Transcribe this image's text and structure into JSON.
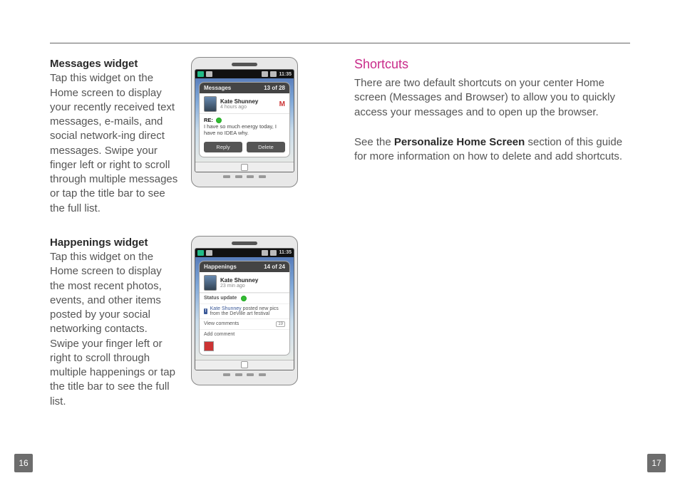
{
  "page_numbers": {
    "left": "16",
    "right": "17"
  },
  "left_column": {
    "messages_widget": {
      "heading": "Messages widget",
      "body": "Tap this widget on the Home screen to display your recently received text messages, e-mails, and social network-ing direct messages. Swipe your finger left or right to scroll through multiple messages or tap the title bar to see the full list."
    },
    "happenings_widget": {
      "heading": "Happenings widget",
      "body": "Tap this widget on the Home screen to display the most recent photos, events, and other items posted by your social networking contacts. Swipe your finger left or right to scroll through multiple happenings or tap the title bar to see the full list."
    }
  },
  "right_column": {
    "heading": "Shortcuts",
    "body1": "There are two default shortcuts on your center Home screen (Messages and Browser) to allow you to quickly access your messages and to open up the browser.",
    "body2_pre": "See the ",
    "body2_bold": "Personalize Home Screen",
    "body2_post": " section of this guide for more information on how to delete and add shortcuts."
  },
  "phone_messages": {
    "statusbar_time": "11:35",
    "card_title": "Messages",
    "card_count": "13 of 28",
    "user_name": "Kate Shunney",
    "user_time": "4 hours ago",
    "mail_icon": "M",
    "subject_prefix": "RE:",
    "subject_icon": "●",
    "message": "I have so much energy today, I have no IDEA why.",
    "btn_reply": "Reply",
    "btn_delete": "Delete"
  },
  "phone_happenings": {
    "statusbar_time": "11:35",
    "card_title": "Happenings",
    "card_count": "14 of 24",
    "user_name": "Kate Shunney",
    "user_time": "23 min ago",
    "status_label": "Status update",
    "post_link": "Kate Shunney",
    "post_text": " posted new pics from the DeVille art festival",
    "view_comments": "View comments",
    "view_count": "19",
    "add_comment": "Add comment"
  }
}
